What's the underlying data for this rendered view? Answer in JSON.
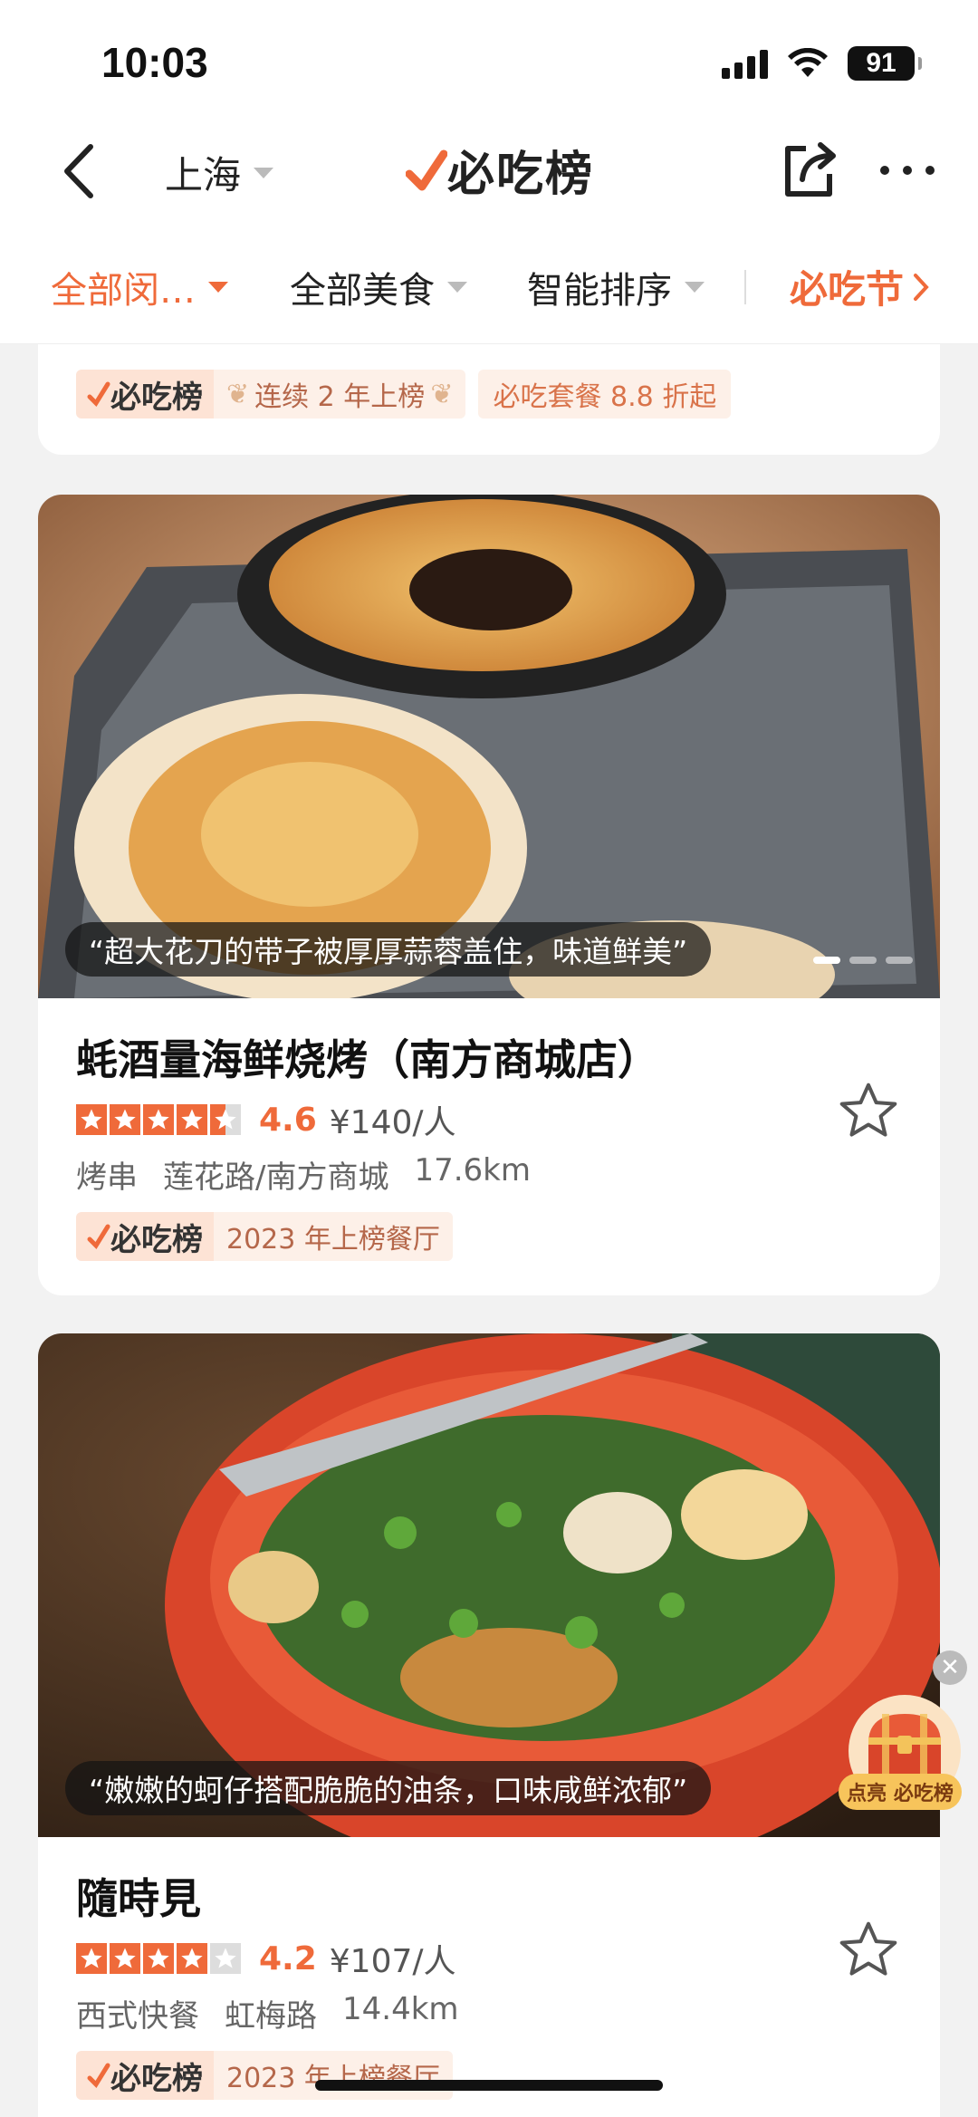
{
  "status_bar": {
    "time": "10:03",
    "battery": "91"
  },
  "nav": {
    "city": "上海",
    "brand": "必吃榜"
  },
  "filters": [
    {
      "label": "全部闵…",
      "active": true
    },
    {
      "label": "全部美食",
      "active": false
    },
    {
      "label": "智能排序",
      "active": false
    }
  ],
  "festival_link": "必吃节",
  "partial_card": {
    "badge_logo": "必吃榜",
    "badge_text": "连续 2 年上榜",
    "promo": "必吃套餐 8.8 折起"
  },
  "restaurants": [
    {
      "quote": "“超大花刀的带子被厚厚蒜蓉盖住，味道鲜美”",
      "name": "蚝酒量海鲜烧烤（南方商城店）",
      "stars": 4.5,
      "score": "4.6",
      "price": "¥140/人",
      "category": "烤串",
      "area": "莲花路/南方商城",
      "distance": "17.6km",
      "badge_logo": "必吃榜",
      "badge_text": "2023 年上榜餐厅"
    },
    {
      "quote": "“嫩嫩的蚵仔搭配脆脆的油条，口味咸鲜浓郁”",
      "name": "隨時見",
      "stars": 4,
      "score": "4.2",
      "price": "¥107/人",
      "category": "西式快餐",
      "area": "虹梅路",
      "distance": "14.4km",
      "badge_logo": "必吃榜",
      "badge_text": "2023 年上榜餐厅"
    }
  ],
  "floating": {
    "label": "点亮 必吃榜"
  },
  "colors": {
    "accent": "#ef6a3a",
    "badge_bg": "#fdf0e8"
  }
}
